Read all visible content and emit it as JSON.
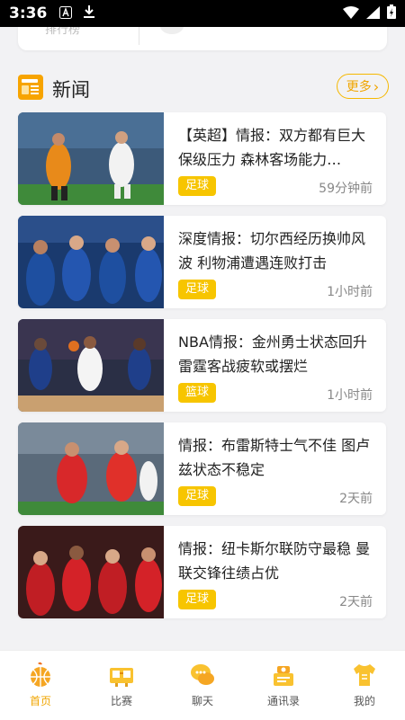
{
  "status_bar": {
    "time": "3:36"
  },
  "top_card": {
    "faded_text": "排行榜"
  },
  "section": {
    "title": "新闻",
    "more_label": "更多"
  },
  "news": [
    {
      "headline": "【英超】情报：双方都有巨大保级压力 森林客场能力…",
      "tag": "足球",
      "time": "59分钟前"
    },
    {
      "headline": "深度情报：切尔西经历换帅风波 利物浦遭遇连败打击",
      "tag": "足球",
      "time": "1小时前"
    },
    {
      "headline": "NBA情报：金州勇士状态回升 雷霆客战疲软或摆烂",
      "tag": "篮球",
      "time": "1小时前"
    },
    {
      "headline": "情报：布雷斯特士气不佳 图卢兹状态不稳定",
      "tag": "足球",
      "time": "2天前"
    },
    {
      "headline": "情报：纽卡斯尔联防守最稳 曼联交锋往绩占优",
      "tag": "足球",
      "time": "2天前"
    }
  ],
  "tabs": [
    {
      "label": "首页",
      "icon": "basketball-icon",
      "active": true
    },
    {
      "label": "比赛",
      "icon": "scoreboard-icon"
    },
    {
      "label": "聊天",
      "icon": "chat-bubbles-icon"
    },
    {
      "label": "通讯录",
      "icon": "contacts-icon"
    },
    {
      "label": "我的",
      "icon": "jersey-icon"
    }
  ],
  "colors": {
    "accent": "#f7c500",
    "accent_text": "#f0a500",
    "background": "#f2f2f4"
  }
}
